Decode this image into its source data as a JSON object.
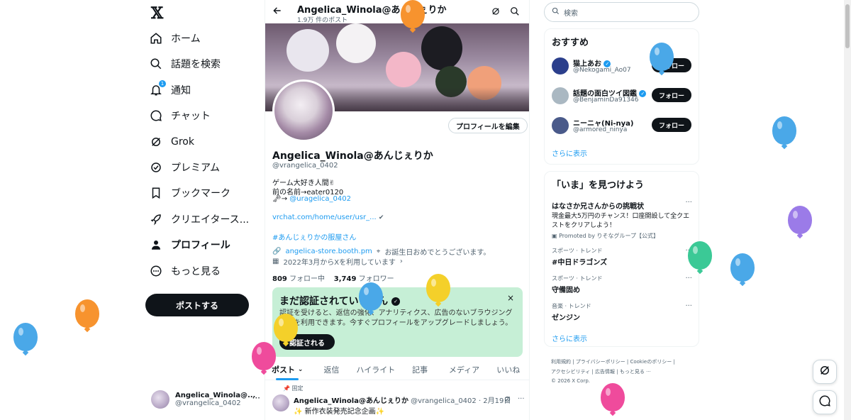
{
  "colors": {
    "accent": "#1d9bf0",
    "dark": "#0f1419",
    "muted": "#536471",
    "verify_bg": "#c6efd6"
  },
  "nav": {
    "logo": "𝕏",
    "items": [
      {
        "label": "ホーム",
        "icon": "home-icon"
      },
      {
        "label": "話題を検索",
        "icon": "search-icon"
      },
      {
        "label": "通知",
        "icon": "bell-icon",
        "badge": "1"
      },
      {
        "label": "チャット",
        "icon": "chat-icon"
      },
      {
        "label": "Grok",
        "icon": "grok-icon"
      },
      {
        "label": "プレミアム",
        "icon": "verified-icon"
      },
      {
        "label": "ブックマーク",
        "icon": "bookmark-icon"
      },
      {
        "label": "クリエイタース...",
        "icon": "rocket-icon"
      },
      {
        "label": "プロフィール",
        "icon": "person-icon"
      },
      {
        "label": "もっと見る",
        "icon": "more-circle-icon"
      }
    ],
    "post_button": "ポストする",
    "account": {
      "name": "Angelica_Winola@...",
      "handle": "@vrangelica_0402",
      "more": "···"
    }
  },
  "header": {
    "title": "Angelica_Winola@あんじぇりか",
    "subtitle": "1.9万 件のポスト"
  },
  "profile": {
    "edit_button": "プロフィールを編集",
    "name": "Angelica_Winola@あんじぇりか",
    "handle": "@vrangelica_0402",
    "bio_line1": "ゲーム大好き人間✌",
    "bio_line2": "前の名前→eater0120",
    "bio_line3_prefix": "🗝→ ",
    "bio_line3_link": "@uragelica_0402",
    "link1": "vrchat.com/home/user/usr_...",
    "hashtag": "#あんじぇりかの服屋さん",
    "website": "angelica-store.booth.pm",
    "location": "お誕生日おめでとうございます。",
    "joined": "2022年3月からXを利用しています",
    "following_count": "809",
    "following_label": "フォロー中",
    "followers_count": "3,749",
    "followers_label": "フォロワー"
  },
  "verify_card": {
    "title": "まだ認証されていません",
    "body": "認証を受けると、返信の強化、アナリティクス、広告のないブラウジングなどを利用できます。今すぐプロフィールをアップグレードしましょう。",
    "button": "認証される",
    "close": "×"
  },
  "tabs": [
    "ポスト",
    "返信",
    "ハイライト",
    "記事",
    "メディア",
    "いいね"
  ],
  "pinned_post": {
    "pinned_label": "固定",
    "name": "Angelica_Winola@あんじぇりか",
    "meta": "@vrangelica_0402 · 2月19日",
    "text": "✨ 新作衣装発売記念企画✨"
  },
  "sidebar": {
    "search_placeholder": "検索",
    "who_to_follow": {
      "title": "おすすめ",
      "users": [
        {
          "name": "猫上あお",
          "handle": "@Nekogami_Ao07",
          "button": "フォロー",
          "color": "#2b3f8c"
        },
        {
          "name": "話題の面白ツイ図鑑",
          "handle": "@BenjaminDa91346",
          "button": "フォロー",
          "color": "#aab8c2"
        },
        {
          "name": "ニーニャ(Ni-nya)",
          "handle": "@armored_ninya",
          "button": "フォロー",
          "color": "#4a5a8a"
        }
      ],
      "more": "さらに表示"
    },
    "trends": {
      "title": "「いま」を見つけよう",
      "items": [
        {
          "title": "はなさか兄さんからの挑戦状",
          "body": "現金最大5万円のチャンス！口座開設して全クエストをクリアしよう！",
          "promo": "Promoted by りそなグループ【公式】"
        },
        {
          "meta": "スポーツ · トレンド",
          "title": "#中日ドラゴンズ"
        },
        {
          "meta": "スポーツ · トレンド",
          "title": "守備固め"
        },
        {
          "meta": "音楽 · トレンド",
          "title": "ゼンジン"
        }
      ],
      "more": "さらに表示"
    },
    "footer_line1": "利用規約 | プライバシーポリシー | Cookieのポリシー |",
    "footer_line2": "アクセシビリティ | 広告情報 | もっと見る ···",
    "footer_line3": "© 2026 X Corp."
  }
}
